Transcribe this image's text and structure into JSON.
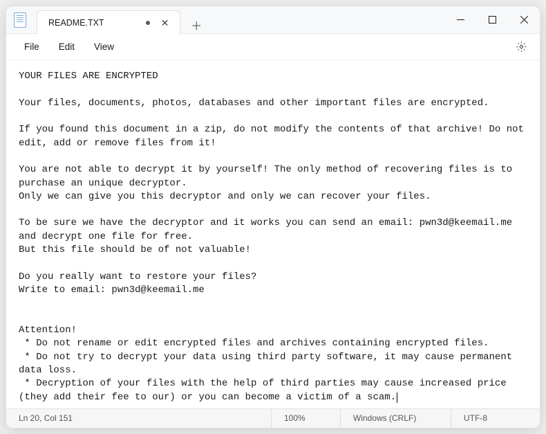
{
  "tab": {
    "title": "README.TXT",
    "modified": true
  },
  "menu": {
    "file": "File",
    "edit": "Edit",
    "view": "View"
  },
  "document": {
    "text": "YOUR FILES ARE ENCRYPTED\n\nYour files, documents, photos, databases and other important files are encrypted.\n\nIf you found this document in a zip, do not modify the contents of that archive! Do not edit, add or remove files from it!\n\nYou are not able to decrypt it by yourself! The only method of recovering files is to purchase an unique decryptor.\nOnly we can give you this decryptor and only we can recover your files.\n\nTo be sure we have the decryptor and it works you can send an email: pwn3d@keemail.me and decrypt one file for free.\nBut this file should be of not valuable!\n\nDo you really want to restore your files?\nWrite to email: pwn3d@keemail.me\n\n\nAttention!\n * Do not rename or edit encrypted files and archives containing encrypted files.\n * Do not try to decrypt your data using third party software, it may cause permanent data loss.\n * Decryption of your files with the help of third parties may cause increased price (they add their fee to our) or you can become a victim of a scam."
  },
  "status": {
    "position": "Ln 20, Col 151",
    "zoom": "100%",
    "eol": "Windows (CRLF)",
    "encoding": "UTF-8"
  }
}
